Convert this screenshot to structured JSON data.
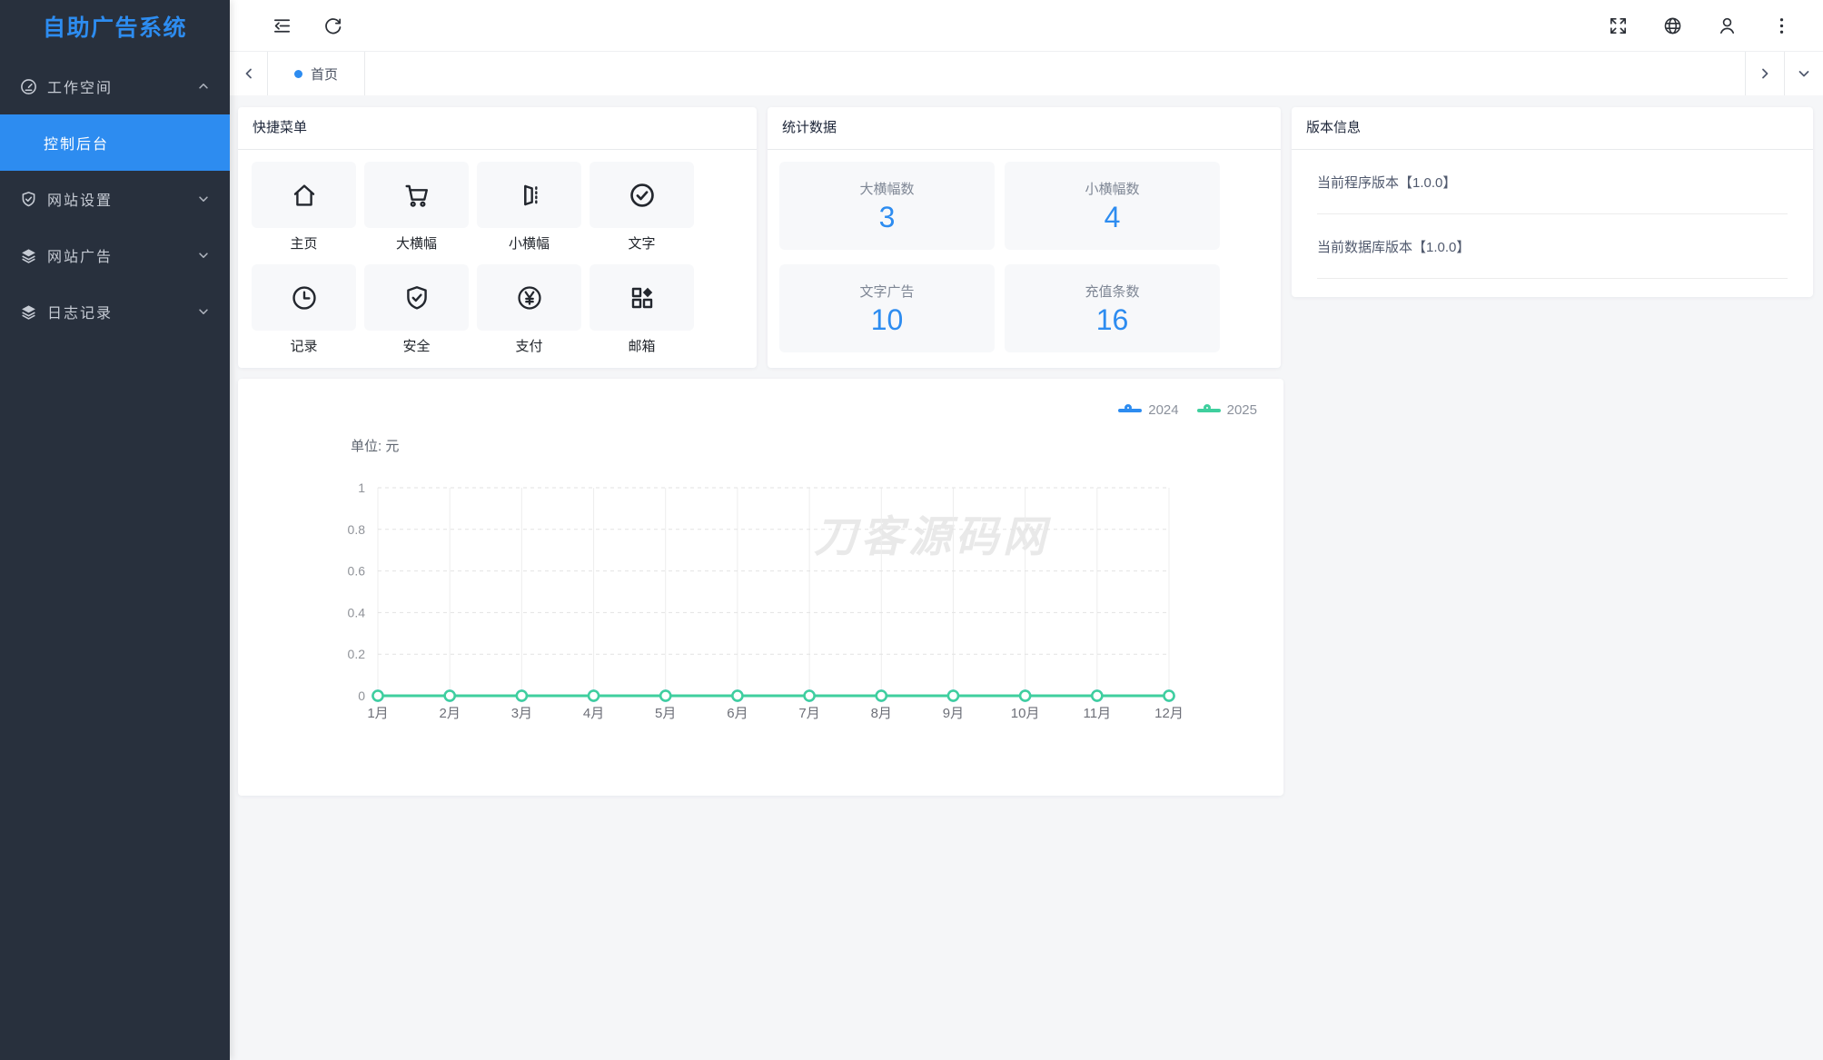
{
  "colors": {
    "primary": "#2d8cf0",
    "series_green": "#3fcf9e",
    "sidebar_bg": "#28303d"
  },
  "sidebar": {
    "logo": "自助广告系统",
    "menu": [
      {
        "label": "工作空间",
        "icon": "dashboard-icon",
        "expanded": true
      },
      {
        "label": "控制后台",
        "active": true
      },
      {
        "label": "网站设置",
        "icon": "shield-check-icon"
      },
      {
        "label": "网站广告",
        "icon": "layers-icon"
      },
      {
        "label": "日志记录",
        "icon": "layers-icon"
      }
    ]
  },
  "header": {
    "icons": [
      "fold-menu-icon",
      "refresh-icon",
      "fullscreen-icon",
      "globe-icon",
      "user-icon",
      "more-vertical-icon"
    ]
  },
  "tabbar": {
    "home_tab": "首页"
  },
  "cards": {
    "quick_menu": {
      "title": "快捷菜单",
      "items": [
        {
          "label": "主页",
          "icon": "home-icon"
        },
        {
          "label": "大横幅",
          "icon": "cart-icon"
        },
        {
          "label": "小横幅",
          "icon": "door-icon"
        },
        {
          "label": "文字",
          "icon": "check-circle-icon"
        },
        {
          "label": "记录",
          "icon": "clock-icon"
        },
        {
          "label": "安全",
          "icon": "shield-icon"
        },
        {
          "label": "支付",
          "icon": "yen-circle-icon"
        },
        {
          "label": "邮箱",
          "icon": "app-grid-icon"
        }
      ]
    },
    "stats": {
      "title": "统计数据",
      "items": [
        {
          "label": "大横幅数",
          "value": "3"
        },
        {
          "label": "小横幅数",
          "value": "4"
        },
        {
          "label": "文字广告",
          "value": "10"
        },
        {
          "label": "充值条数",
          "value": "16"
        }
      ]
    },
    "version": {
      "title": "版本信息",
      "items": [
        "当前程序版本【1.0.0】",
        "当前数据库版本【1.0.0】"
      ]
    }
  },
  "chart_data": {
    "type": "line",
    "unit_label": "单位: 元",
    "x": [
      "1月",
      "2月",
      "3月",
      "4月",
      "5月",
      "6月",
      "7月",
      "8月",
      "9月",
      "10月",
      "11月",
      "12月"
    ],
    "series": [
      {
        "name": "2024",
        "color": "#2d8cf0",
        "values": [
          0,
          0,
          0,
          0,
          0,
          0,
          0,
          0,
          0,
          0,
          0,
          0
        ]
      },
      {
        "name": "2025",
        "color": "#3fcf9e",
        "values": [
          0,
          0,
          0,
          0,
          0,
          0,
          0,
          0,
          0,
          0,
          0,
          0
        ]
      }
    ],
    "ylim": [
      0,
      1
    ],
    "yticks": [
      0,
      0.2,
      0.4,
      0.6,
      0.8,
      1
    ],
    "legend_position": "top-right",
    "grid": true,
    "watermark": "刀客源码网"
  }
}
